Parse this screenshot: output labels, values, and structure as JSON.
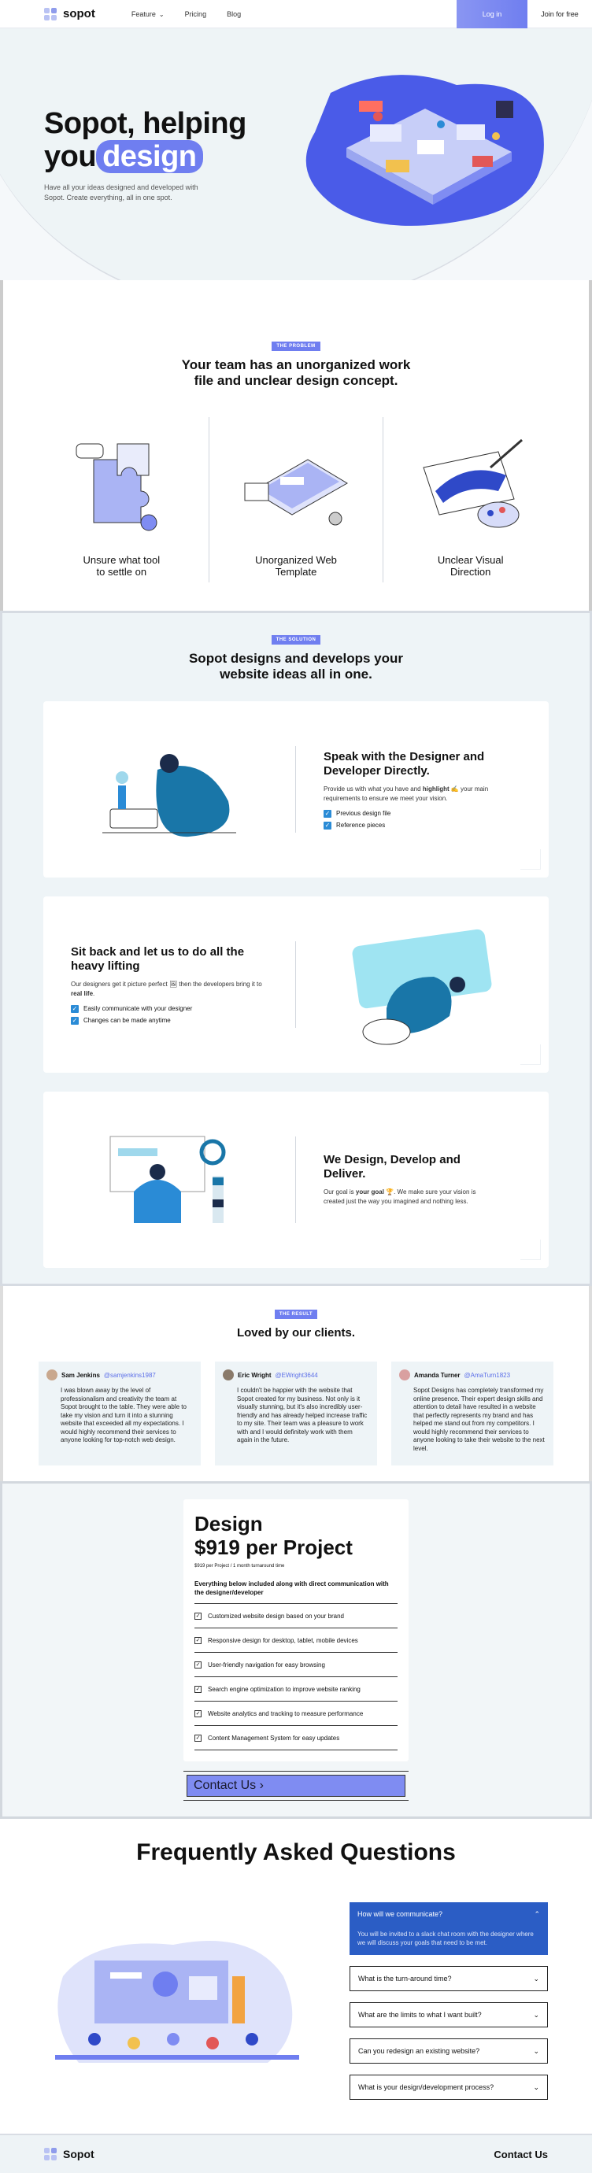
{
  "nav": {
    "brand": "sopot",
    "links": [
      "Feature",
      "Pricing",
      "Blog"
    ],
    "login": "Log in",
    "join": "Join for free"
  },
  "hero": {
    "title_line1": "Sopot, helping",
    "title_you": "you",
    "title_highlight": "design",
    "subtitle": "Have all your ideas designed and developed with Sopot. Create everything, all in one spot."
  },
  "problem": {
    "tag": "THE PROBLEM",
    "title": "Your team has an unorganized work file and unclear design concept.",
    "items": [
      "Unsure what tool to settle on",
      "Unorganized Web Template",
      "Unclear Visual Direction"
    ]
  },
  "solution": {
    "tag": "THE SOLUTION",
    "title": "Sopot designs and develops your website ideas all in one.",
    "cards": [
      {
        "title": "Speak with the Designer and Developer Directly.",
        "desc_a": "Provide us with what you have and ",
        "desc_bold": "highlight",
        "desc_b": " ✍ your main requirements to ensure we meet your vision.",
        "checks": [
          "Previous design file",
          "Reference pieces"
        ]
      },
      {
        "title": "Sit back and let us to do all the heavy lifting",
        "desc_a": "Our designers get it picture perfect 🖼 then the developers bring it to ",
        "desc_bold": "real life",
        "desc_b": ".",
        "checks": [
          "Easily communicate with your designer",
          "Changes can be made anytime"
        ]
      },
      {
        "title": "We Design, Develop and Deliver.",
        "desc_a": "Our goal is ",
        "desc_bold": "your goal",
        "desc_b": " 🏆. We make sure your vision is created just the way you imagined and nothing less."
      }
    ]
  },
  "result": {
    "tag": "THE RESULT",
    "title": "Loved by our clients.",
    "testimonials": [
      {
        "name": "Sam Jenkins",
        "handle": "@samjenkins1987",
        "text": "I was blown away by the level of professionalism and creativity the team at Sopot brought to the table. They were able to take my vision and turn it into a stunning website that exceeded all my expectations. I would highly recommend their services to anyone looking for top-notch web design."
      },
      {
        "name": "Eric Wright",
        "handle": "@EWright3644",
        "text": "I couldn't be happier with the website that Sopot created for my business. Not only is it visually stunning, but it's also incredibly user-friendly and has already helped increase traffic to my site. Their team was a pleasure to work with and I would definitely work with them again in the future."
      },
      {
        "name": "Amanda Turner",
        "handle": "@AmaTurn1823",
        "text": "Sopot Designs has completely transformed my online presence. Their expert design skills and attention to detail have resulted in a website that perfectly represents my brand and has helped me stand out from my competitors. I would highly recommend their services to anyone looking to take their website to the next level."
      }
    ]
  },
  "pricing": {
    "title_line1": "Design",
    "title_line2": "$919 per Project",
    "small": "$919 per Project / 1 month turnaround time",
    "head": "Everything below included along with direct communication with the designer/developer",
    "features": [
      "Customized website design based on your brand",
      "Responsive design for desktop, tablet, mobile devices",
      "User-friendly navigation for easy browsing",
      "Search engine optimization to improve website ranking",
      "Website analytics and tracking to measure performance",
      "Content Management System for easy updates"
    ],
    "cta": "Contact Us",
    "cta_arrow": "›"
  },
  "faq": {
    "title": "Frequently Asked Questions",
    "open_question": "How will we communicate?",
    "open_answer": "You will be invited to a slack chat room with the designer where we will discuss your goals that need to be met.",
    "questions": [
      "What is the turn-around time?",
      "What are the limits to what I want built?",
      "Can you redesign an existing website?",
      "What is your design/development process?"
    ]
  },
  "footer": {
    "brand": "Sopot",
    "contact": "Contact Us"
  }
}
